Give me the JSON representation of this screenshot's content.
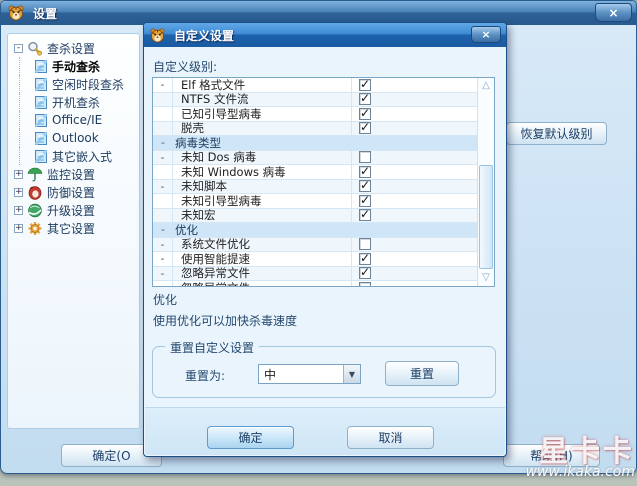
{
  "window": {
    "title": "设置",
    "close_label": "×",
    "tree": {
      "items": [
        {
          "label": "查杀设置",
          "icon": "search-icon",
          "expander": "-",
          "level": 0,
          "selected": false
        },
        {
          "label": "手动查杀",
          "icon": "doc-icon",
          "expander": "",
          "level": 1,
          "selected": true
        },
        {
          "label": "空闲时段查杀",
          "icon": "doc-icon",
          "expander": "",
          "level": 1,
          "selected": false
        },
        {
          "label": "开机查杀",
          "icon": "doc-icon",
          "expander": "",
          "level": 1,
          "selected": false
        },
        {
          "label": "Office/IE",
          "icon": "doc-icon",
          "expander": "",
          "level": 1,
          "selected": false
        },
        {
          "label": "Outlook",
          "icon": "doc-icon",
          "expander": "",
          "level": 1,
          "selected": false
        },
        {
          "label": "其它嵌入式",
          "icon": "doc-icon",
          "expander": "",
          "level": 1,
          "selected": false
        },
        {
          "label": "监控设置",
          "icon": "umbrella-icon",
          "expander": "+",
          "level": 0,
          "selected": false
        },
        {
          "label": "防御设置",
          "icon": "glove-icon",
          "expander": "+",
          "level": 0,
          "selected": false
        },
        {
          "label": "升级设置",
          "icon": "globe-icon",
          "expander": "+",
          "level": 0,
          "selected": false
        },
        {
          "label": "其它设置",
          "icon": "gear-icon",
          "expander": "+",
          "level": 0,
          "selected": false
        }
      ]
    },
    "restore_default_button": "恢复默认级别",
    "ok_button": "确定(O",
    "help_button": "帮助(H)",
    "watermark": {
      "brand": "星卡卡",
      "url": "www.ikaka.com"
    }
  },
  "dialog": {
    "title": "自定义设置",
    "close_label": "×",
    "level_label": "自定义级别:",
    "list": {
      "rows": [
        {
          "type": "item",
          "marker": "-",
          "label": "Elf 格式文件",
          "checked": true
        },
        {
          "type": "item",
          "marker": "",
          "label": "NTFS 文件流",
          "checked": true
        },
        {
          "type": "item",
          "marker": "",
          "label": "已知引导型病毒",
          "checked": true
        },
        {
          "type": "item",
          "marker": "",
          "label": "脱壳",
          "checked": true
        },
        {
          "type": "group",
          "marker": "-",
          "label": "病毒类型"
        },
        {
          "type": "item",
          "marker": "-",
          "label": "未知 Dos 病毒",
          "checked": false
        },
        {
          "type": "item",
          "marker": "",
          "label": "未知 Windows 病毒",
          "checked": true
        },
        {
          "type": "item",
          "marker": "-",
          "label": "未知脚本",
          "checked": true
        },
        {
          "type": "item",
          "marker": "",
          "label": "未知引导型病毒",
          "checked": true
        },
        {
          "type": "item",
          "marker": "",
          "label": "未知宏",
          "checked": true
        },
        {
          "type": "group",
          "marker": "-",
          "label": "优化"
        },
        {
          "type": "item",
          "marker": "-",
          "label": "系统文件优化",
          "checked": false
        },
        {
          "type": "item",
          "marker": "-",
          "label": "使用智能提速",
          "checked": true
        },
        {
          "type": "item",
          "marker": "-",
          "label": "忽略异常文件",
          "checked": true
        },
        {
          "type": "item",
          "marker": "",
          "label": "忽略异常文件",
          "checked": false
        }
      ]
    },
    "description": {
      "title": "优化",
      "text": "使用优化可以加快杀毒速度"
    },
    "reset_group": {
      "title": "重置自定义设置",
      "label": "重置为:",
      "selected_value": "中",
      "reset_button": "重置"
    },
    "ok_button": "确定",
    "cancel_button": "取消"
  },
  "colors": {
    "titlebar_blue": "#2e6196",
    "dialog_title_blue": "#1d62ac",
    "accent_blue": "#5e9bd0",
    "group_row_bg": "#cfe6f8",
    "body_bg": "#d9eaf8"
  }
}
